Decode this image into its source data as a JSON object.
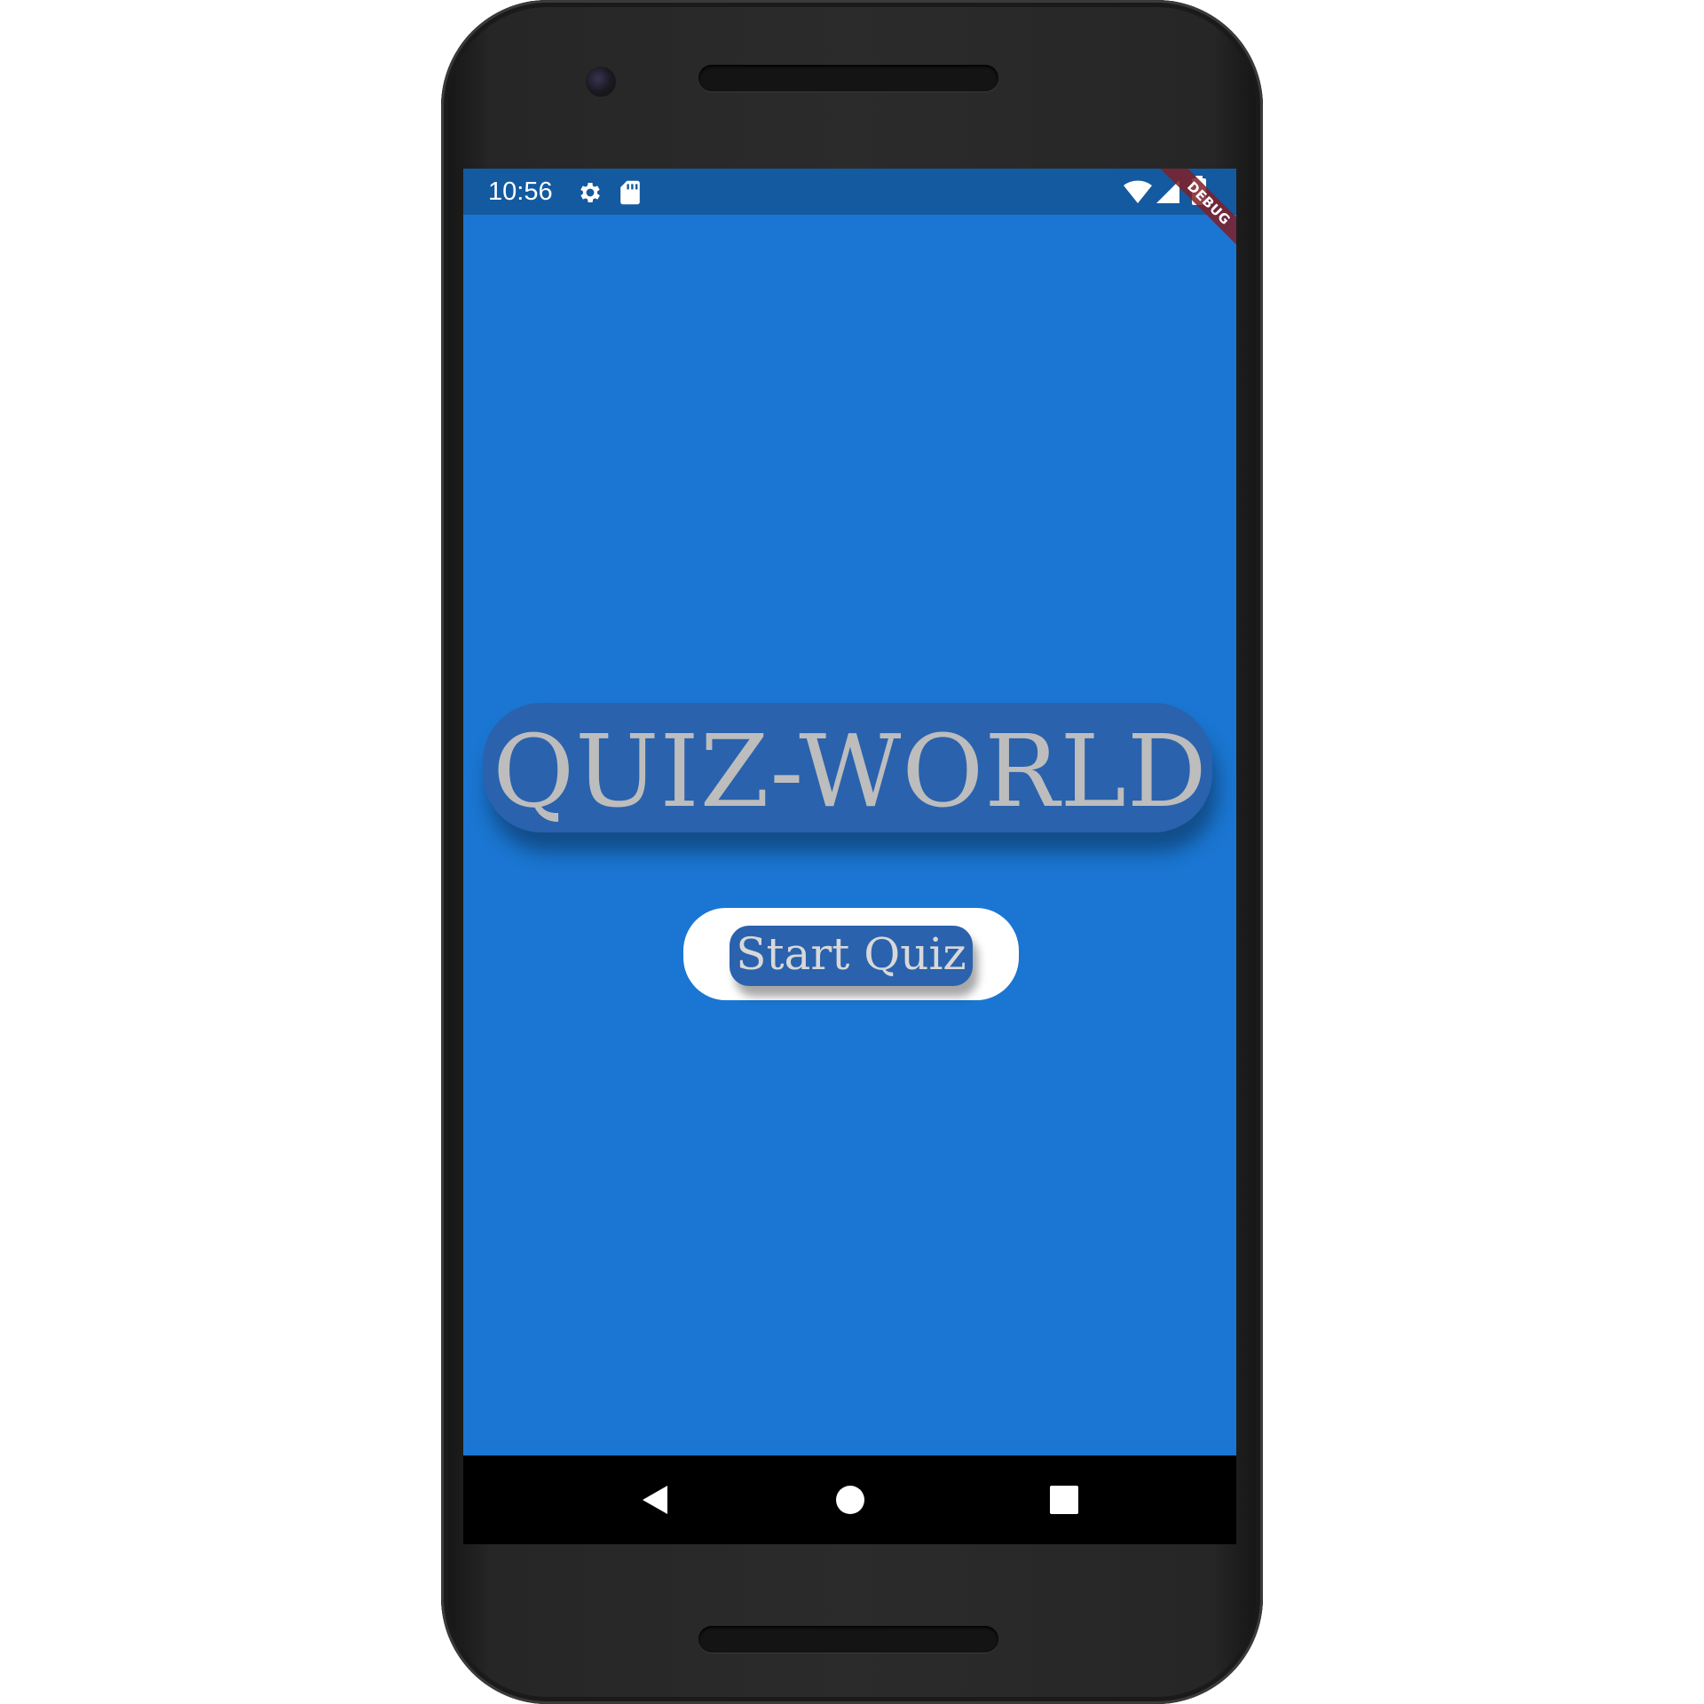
{
  "status_bar": {
    "time": "10:56",
    "icons": [
      "gear-icon",
      "sd-card-icon",
      "wifi-icon",
      "signal-icon",
      "battery-icon"
    ]
  },
  "debug_banner": "DEBUG",
  "main": {
    "title": "QUIZ-WORLD",
    "start_button_label": "Start Quiz"
  },
  "nav_bar": {
    "icons": [
      "back-icon",
      "home-icon",
      "recents-icon"
    ]
  },
  "colors": {
    "background": "#1a76d2",
    "status_bar": "#135aa0",
    "title_pill": "#2a62ad",
    "title_text": "#bdbdbd",
    "button": "#ffffff",
    "debug_ribbon": "#801e28"
  }
}
